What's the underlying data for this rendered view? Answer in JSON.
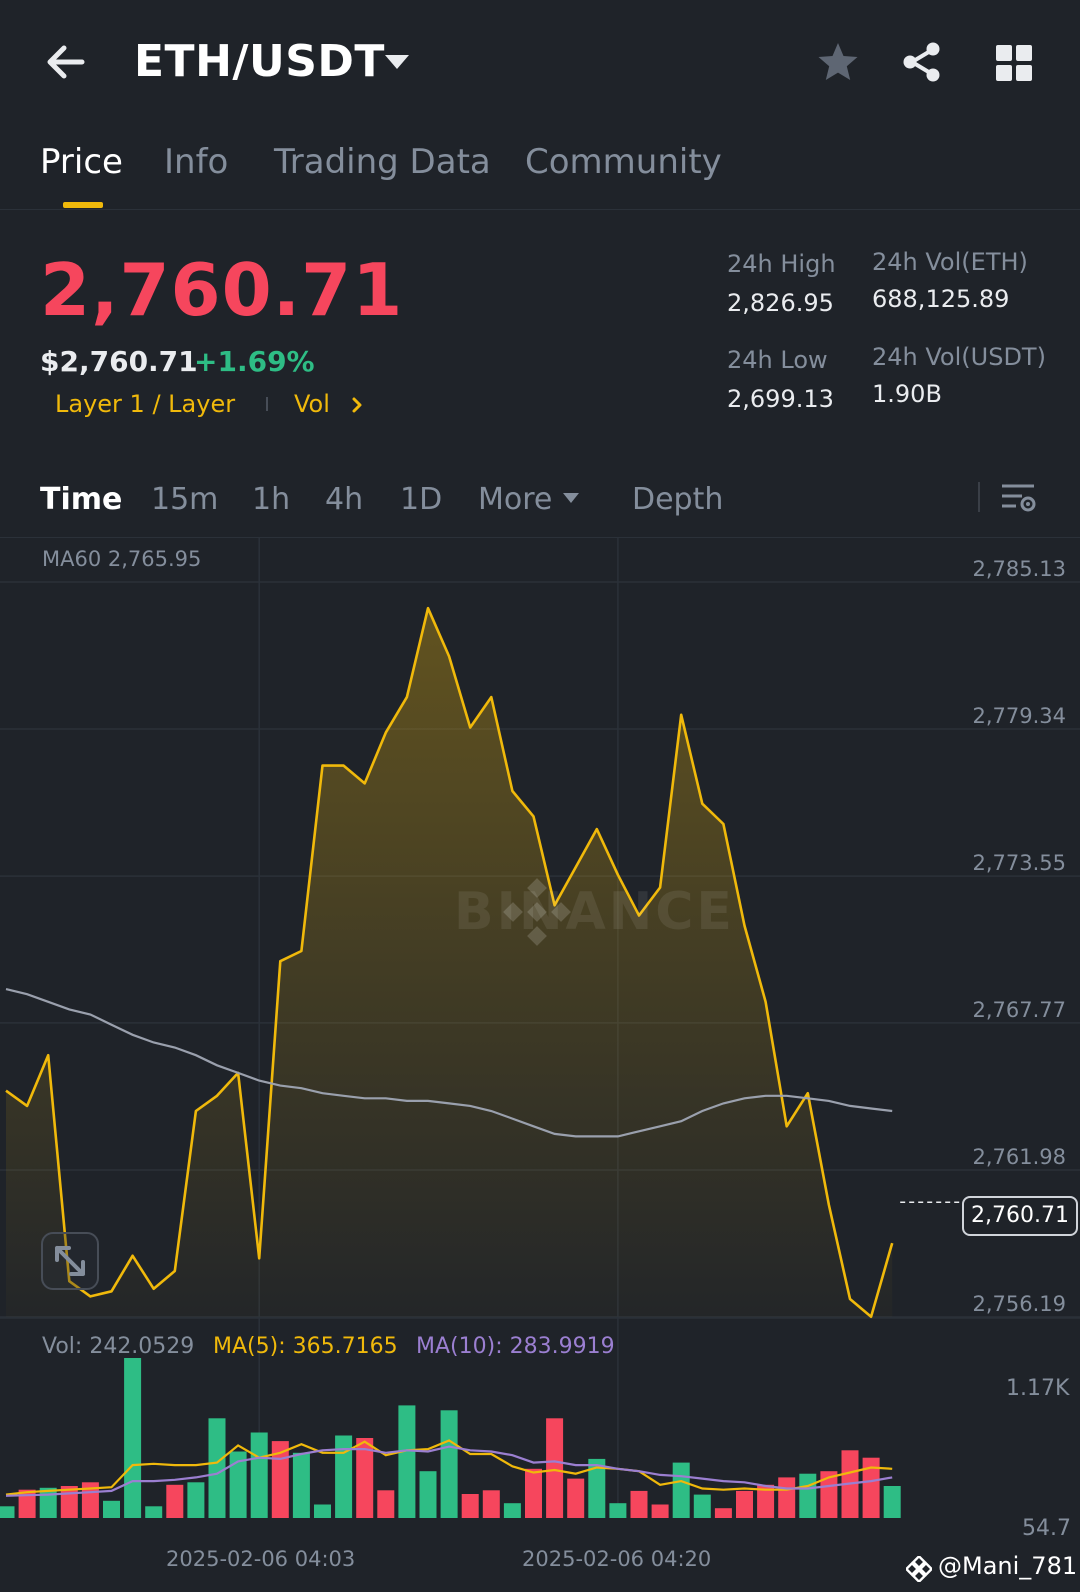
{
  "header": {
    "pair": "ETH/USDT",
    "icons": [
      "back-arrow-icon",
      "dropdown-icon",
      "star-icon",
      "share-icon",
      "grid-icon"
    ]
  },
  "tabs": [
    {
      "label": "Price",
      "active": true
    },
    {
      "label": "Info",
      "active": false
    },
    {
      "label": "Trading Data",
      "active": false
    },
    {
      "label": "Community",
      "active": false
    }
  ],
  "ticker": {
    "last_price": "2,760.71",
    "usd_price": "$2,760.71",
    "change": "+1.69%",
    "tag": "Layer 1 / Layer",
    "vol_link": "Vol"
  },
  "stats": {
    "high_label": "24h High",
    "high_value": "2,826.95",
    "low_label": "24h Low",
    "low_value": "2,699.13",
    "vol_eth_label": "24h Vol(ETH)",
    "vol_eth_value": "688,125.89",
    "vol_usdt_label": "24h Vol(USDT)",
    "vol_usdt_value": "1.90B"
  },
  "intervals": [
    {
      "label": "Time",
      "active": true
    },
    {
      "label": "15m",
      "active": false
    },
    {
      "label": "1h",
      "active": false
    },
    {
      "label": "4h",
      "active": false
    },
    {
      "label": "1D",
      "active": false
    },
    {
      "label": "More",
      "active": false
    },
    {
      "label": "Depth",
      "active": false
    }
  ],
  "colors": {
    "up": "#2ebd85",
    "down": "#f6465d",
    "accent": "#f0b90b",
    "ma60": "#9aa0ad",
    "ma10": "#9b7fd1",
    "background": "#1f2329"
  },
  "watermark": "BINANCE",
  "credit": "@Mani_781",
  "chart_data": [
    {
      "type": "area",
      "legend": "MA60 2,765.95",
      "ylim": [
        2756.19,
        2785.13
      ],
      "y_ticks": [
        "2,785.13",
        "2,779.34",
        "2,773.55",
        "2,767.77",
        "2,761.98",
        "2,756.19"
      ],
      "y_tick_values": [
        2785.13,
        2779.34,
        2773.55,
        2767.77,
        2761.98,
        2756.19
      ],
      "current_price": "2,760.71",
      "current_value": 2760.71,
      "x_labels": [
        "2025-02-06 04:03",
        "2025-02-06 04:20"
      ],
      "x_label_index": [
        12,
        29
      ],
      "series": [
        {
          "name": "Price",
          "values": [
            2765.1,
            2764.5,
            2766.5,
            2757.6,
            2757.0,
            2757.2,
            2758.6,
            2757.3,
            2758.0,
            2764.3,
            2764.9,
            2765.8,
            2758.5,
            2770.2,
            2770.6,
            2777.9,
            2777.9,
            2777.2,
            2779.2,
            2780.6,
            2784.1,
            2782.2,
            2779.4,
            2780.6,
            2776.9,
            2775.9,
            2772.4,
            2773.9,
            2775.4,
            2773.6,
            2772.0,
            2773.1,
            2779.9,
            2776.4,
            2775.6,
            2771.6,
            2768.6,
            2763.7,
            2765.0,
            2760.6,
            2756.9,
            2756.2,
            2759.1
          ]
        },
        {
          "name": "MA60",
          "values": [
            2769.1,
            2768.9,
            2768.6,
            2768.3,
            2768.1,
            2767.7,
            2767.3,
            2767.0,
            2766.8,
            2766.5,
            2766.1,
            2765.8,
            2765.5,
            2765.3,
            2765.2,
            2765.0,
            2764.9,
            2764.8,
            2764.8,
            2764.7,
            2764.7,
            2764.6,
            2764.5,
            2764.3,
            2764.0,
            2763.7,
            2763.4,
            2763.3,
            2763.3,
            2763.3,
            2763.5,
            2763.7,
            2763.9,
            2764.3,
            2764.6,
            2764.8,
            2764.9,
            2764.9,
            2764.8,
            2764.7,
            2764.5,
            2764.4,
            2764.3
          ]
        }
      ]
    },
    {
      "type": "bar",
      "legend_vol": "Vol: 242.0529",
      "legend_ma5": "MA(5): 365.7165",
      "legend_ma10": "MA(10): 283.9919",
      "ylim": [
        0,
        1300
      ],
      "y_ticks": [
        "1.17K",
        "54.7"
      ],
      "y_tick_values": [
        1170,
        54.7
      ],
      "series": [
        {
          "name": "Vol",
          "values": [
            95,
            230,
            245,
            260,
            290,
            140,
            1300,
            95,
            270,
            290,
            810,
            540,
            695,
            625,
            530,
            110,
            670,
            650,
            225,
            915,
            380,
            875,
            195,
            225,
            120,
            400,
            810,
            320,
            480,
            120,
            220,
            110,
            450,
            190,
            80,
            220,
            270,
            330,
            360,
            380,
            550,
            490,
            260
          ],
          "up": [
            true,
            false,
            true,
            false,
            false,
            true,
            true,
            true,
            false,
            true,
            true,
            true,
            true,
            false,
            true,
            true,
            true,
            false,
            false,
            true,
            true,
            true,
            false,
            false,
            true,
            false,
            false,
            false,
            true,
            true,
            false,
            false,
            true,
            true,
            false,
            false,
            false,
            false,
            true,
            false,
            false,
            false,
            true
          ]
        },
        {
          "name": "MA(5)",
          "values": [
            190,
            210,
            220,
            230,
            240,
            250,
            430,
            440,
            430,
            430,
            450,
            590,
            490,
            530,
            600,
            530,
            530,
            620,
            510,
            550,
            560,
            630,
            520,
            520,
            420,
            370,
            390,
            360,
            410,
            400,
            380,
            270,
            300,
            240,
            230,
            240,
            230,
            230,
            260,
            330,
            370,
            410,
            400
          ]
        },
        {
          "name": "MA(10)",
          "values": [
            180,
            185,
            190,
            200,
            210,
            220,
            300,
            300,
            310,
            330,
            360,
            460,
            490,
            480,
            520,
            550,
            560,
            560,
            530,
            550,
            540,
            580,
            550,
            540,
            510,
            450,
            460,
            430,
            430,
            400,
            380,
            350,
            340,
            320,
            300,
            290,
            260,
            240,
            240,
            260,
            280,
            300,
            330
          ]
        }
      ]
    }
  ]
}
